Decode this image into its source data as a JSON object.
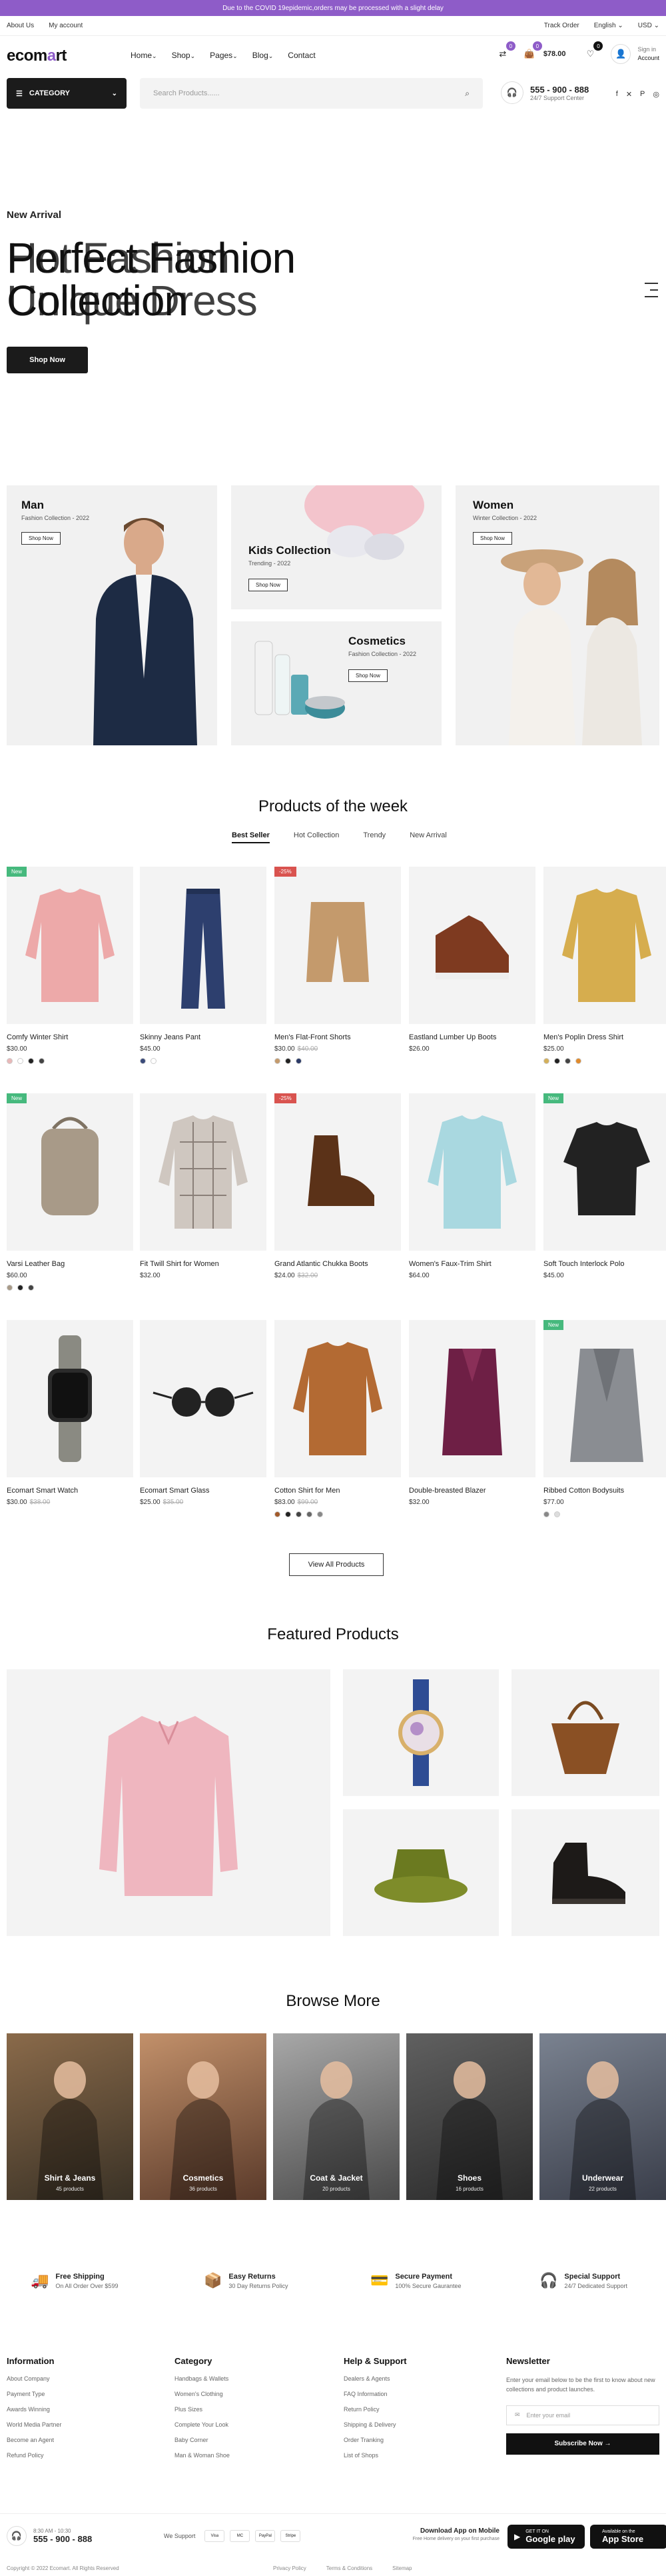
{
  "announcement": "Due to the COVID 19epidemic,orders may be processed with a slight delay",
  "topbar": {
    "left": [
      "About Us",
      "My account"
    ],
    "right": [
      "Track Order",
      "English",
      "USD"
    ]
  },
  "header": {
    "logo_pre": "ecom",
    "logo_o": "a",
    "logo_post": "rt",
    "nav": [
      "Home",
      "Shop",
      "Pages",
      "Blog",
      "Contact"
    ],
    "compare_count": "0",
    "cart_total": "$78.00",
    "cart_count": "0",
    "signin_top": "Sign in",
    "signin_bottom": "Account"
  },
  "category_button": "CATEGORY",
  "search": {
    "placeholder": "Search Products......"
  },
  "support": {
    "phone": "555 - 900 - 888",
    "label": "24/7 Support Center"
  },
  "social": [
    "f",
    "✕",
    "P",
    "◎"
  ],
  "hero": {
    "eyebrow": "New Arrival",
    "line1a": "Perfect Fashion",
    "line2a": "Collection",
    "line1b": "Hot Fashion",
    "line2b": "Unique Dress",
    "button": "Shop Now"
  },
  "banners": {
    "man": {
      "title": "Man",
      "sub": "Fashion Collection - 2022",
      "btn": "Shop Now"
    },
    "kids": {
      "title": "Kids Collection",
      "sub": "Trending - 2022",
      "btn": "Shop Now"
    },
    "cosmetics": {
      "title": "Cosmetics",
      "sub": "Fashion Collection - 2022",
      "btn": "Shop Now"
    },
    "women": {
      "title": "Women",
      "sub": "Winter Collection - 2022",
      "btn": "Shop Now"
    }
  },
  "products_week": {
    "title": "Products of the week",
    "tabs": [
      "Best Seller",
      "Hot Collection",
      "Trendy",
      "New Arrival"
    ],
    "active_tab_index": 0,
    "view_all": "View All Products",
    "items": [
      {
        "name": "Comfy Winter Shirt",
        "price": "$30.00",
        "old": "",
        "tag": "New",
        "swatches": [
          "#e9b8b8",
          "#ffffff",
          "#222",
          "#444"
        ]
      },
      {
        "name": "Skinny Jeans Pant",
        "price": "$45.00",
        "old": "",
        "tag": "",
        "swatches": [
          "#3a4a7a",
          "#ffffff"
        ]
      },
      {
        "name": "Men's Flat-Front Shorts",
        "price": "$30.00",
        "old": "$40.00",
        "tag": "-25%",
        "swatches": [
          "#c49a6c",
          "#222",
          "#2b3a67"
        ]
      },
      {
        "name": "Eastland Lumber Up Boots",
        "price": "$26.00",
        "old": "",
        "tag": "",
        "swatches": []
      },
      {
        "name": "Men's Poplin Dress Shirt",
        "price": "$25.00",
        "old": "",
        "tag": "",
        "swatches": [
          "#d4b05a",
          "#222",
          "#444",
          "#e08a2c"
        ]
      },
      {
        "name": "Varsi Leather Bag",
        "price": "$60.00",
        "old": "",
        "tag": "New",
        "swatches": [
          "#a89a88",
          "#222",
          "#444"
        ]
      },
      {
        "name": "Fit Twill Shirt for Women",
        "price": "$32.00",
        "old": "",
        "tag": "",
        "swatches": []
      },
      {
        "name": "Grand Atlantic Chukka Boots",
        "price": "$24.00",
        "old": "$32.00",
        "tag": "-25%",
        "swatches": []
      },
      {
        "name": "Women's Faux-Trim Shirt",
        "price": "$64.00",
        "old": "",
        "tag": "",
        "swatches": []
      },
      {
        "name": "Soft Touch Interlock Polo",
        "price": "$45.00",
        "old": "",
        "tag": "New",
        "swatches": []
      },
      {
        "name": "Ecomart Smart Watch",
        "price": "$30.00",
        "old": "$38.00",
        "tag": "",
        "swatches": []
      },
      {
        "name": "Ecomart Smart Glass",
        "price": "$25.00",
        "old": "$35.00",
        "tag": "",
        "swatches": []
      },
      {
        "name": "Cotton Shirt for Men",
        "price": "$83.00",
        "old": "$99.00",
        "tag": "",
        "swatches": [
          "#a25a2a",
          "#222",
          "#444",
          "#666",
          "#888"
        ]
      },
      {
        "name": "Double-breasted Blazer",
        "price": "$32.00",
        "old": "",
        "tag": "",
        "swatches": []
      },
      {
        "name": "Ribbed Cotton Bodysuits",
        "price": "$77.00",
        "old": "",
        "tag": "New",
        "swatches": [
          "#888",
          "#ddd"
        ]
      }
    ]
  },
  "featured": {
    "title": "Featured Products"
  },
  "browse": {
    "title": "Browse More",
    "items": [
      {
        "label": "Shirt & Jeans",
        "count": "45 products"
      },
      {
        "label": "Cosmetics",
        "count": "36 products"
      },
      {
        "label": "Coat & Jacket",
        "count": "20 products"
      },
      {
        "label": "Shoes",
        "count": "16 products"
      },
      {
        "label": "Underwear",
        "count": "22 products"
      }
    ]
  },
  "features": [
    {
      "title": "Free Shipping",
      "sub": "On All Order Over $599"
    },
    {
      "title": "Easy Returns",
      "sub": "30 Day Returns Policy"
    },
    {
      "title": "Secure Payment",
      "sub": "100% Secure Gaurantee"
    },
    {
      "title": "Special Support",
      "sub": "24/7 Dedicated Support"
    }
  ],
  "footer": {
    "info_title": "Information",
    "info": [
      "About Company",
      "Payment Type",
      "Awards Winning",
      "World Media Partner",
      "Become an Agent",
      "Refund Policy"
    ],
    "cat_title": "Category",
    "cat": [
      "Handbags & Wallets",
      "Women's Clothing",
      "Plus Sizes",
      "Complete Your Look",
      "Baby Corner",
      "Man & Woman Shoe"
    ],
    "help_title": "Help & Support",
    "help": [
      "Dealers & Agents",
      "FAQ Information",
      "Return Policy",
      "Shipping & Delivery",
      "Order Tranking",
      "List of Shops"
    ],
    "newsletter_title": "Newsletter",
    "newsletter_text": "Enter your email below to be the first to know about new collections and product launches.",
    "email_placeholder": "Enter your email",
    "subscribe": "Subscribe Now →"
  },
  "bottombar": {
    "hours": "8:30 AM - 10:30",
    "phone": "555 - 900 - 888",
    "we_support": "We Support",
    "payments": [
      "Visa",
      "MC",
      "PayPal",
      "Stripe"
    ],
    "app_title": "Download App on Mobile",
    "app_sub": "Free Home delivery on your first purchase",
    "google_sm": "GET IT ON",
    "google_lg": "Google play",
    "apple_sm": "Available on the",
    "apple_lg": "App Store"
  },
  "copyright": "Copyright © 2022 Ecomart. All Rights Reserved",
  "bottom_links": [
    "Privacy Policy",
    "Terms & Conditions",
    "Sitemap"
  ]
}
